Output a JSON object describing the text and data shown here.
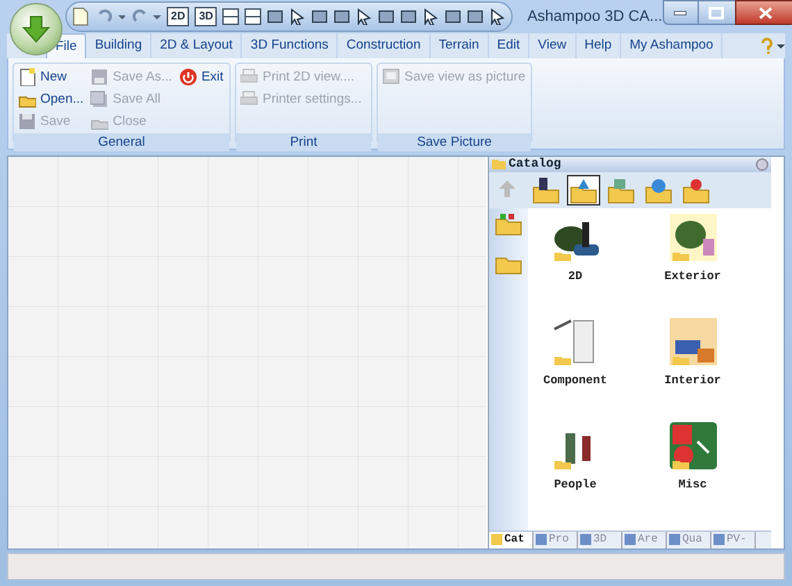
{
  "window": {
    "title": "Ashampoo 3D CA..."
  },
  "quick_access": [
    "2D",
    "3D"
  ],
  "tabs": [
    {
      "label": "File",
      "selected": true
    },
    {
      "label": "Building",
      "selected": false
    },
    {
      "label": "2D & Layout",
      "selected": false
    },
    {
      "label": "3D Functions",
      "selected": false
    },
    {
      "label": "Construction",
      "selected": false
    },
    {
      "label": "Terrain",
      "selected": false
    },
    {
      "label": "Edit",
      "selected": false
    },
    {
      "label": "View",
      "selected": false
    },
    {
      "label": "Help",
      "selected": false
    },
    {
      "label": "My Ashampoo",
      "selected": false
    }
  ],
  "ribbon_groups": [
    {
      "title": "General",
      "buttons": [
        {
          "label": "New",
          "disabled": false
        },
        {
          "label": "Open...",
          "disabled": false
        },
        {
          "label": "Save",
          "disabled": true
        },
        {
          "label": "Save As...",
          "disabled": true
        },
        {
          "label": "Save All",
          "disabled": true
        },
        {
          "label": "Close",
          "disabled": true
        },
        {
          "label": "Exit",
          "disabled": false
        }
      ]
    },
    {
      "title": "Print",
      "buttons": [
        {
          "label": "Print 2D view....",
          "disabled": true
        },
        {
          "label": "Printer settings...",
          "disabled": true
        }
      ]
    },
    {
      "title": "Save Picture",
      "buttons": [
        {
          "label": "Save view as picture",
          "disabled": true
        }
      ]
    }
  ],
  "catalog": {
    "title": "Catalog",
    "items": [
      {
        "label": "2D"
      },
      {
        "label": "Exterior"
      },
      {
        "label": "Component"
      },
      {
        "label": "Interior"
      },
      {
        "label": "People"
      },
      {
        "label": "Misc"
      }
    ],
    "bottom_tabs": [
      {
        "label": "Cat",
        "selected": true
      },
      {
        "label": "Pro",
        "selected": false
      },
      {
        "label": "3D",
        "selected": false
      },
      {
        "label": "Are",
        "selected": false
      },
      {
        "label": "Qua",
        "selected": false
      },
      {
        "label": "PV-",
        "selected": false
      }
    ]
  }
}
